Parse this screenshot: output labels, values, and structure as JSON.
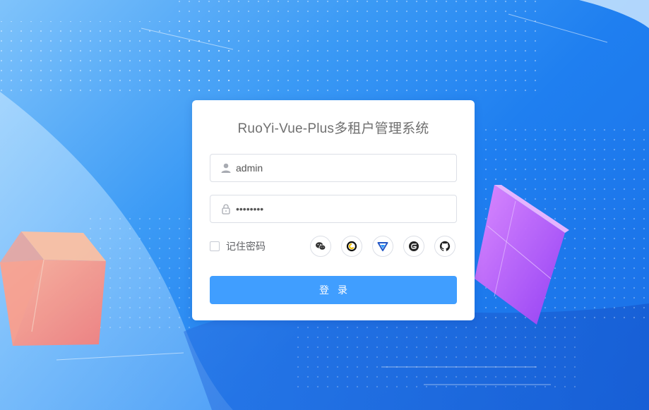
{
  "login": {
    "title": "RuoYi-Vue-Plus多租户管理系统",
    "username_value": "admin",
    "password_value": "••••••••",
    "remember_label": "记住密码",
    "login_button": "登录"
  },
  "social_logins": [
    {
      "icon": "wechat-icon"
    },
    {
      "icon": "maxkey-icon"
    },
    {
      "icon": "topiam-icon"
    },
    {
      "icon": "gitee-icon"
    },
    {
      "icon": "github-icon"
    }
  ],
  "colors": {
    "primary": "#409eff",
    "background": "#1f7ff0",
    "title_text": "#707070"
  }
}
